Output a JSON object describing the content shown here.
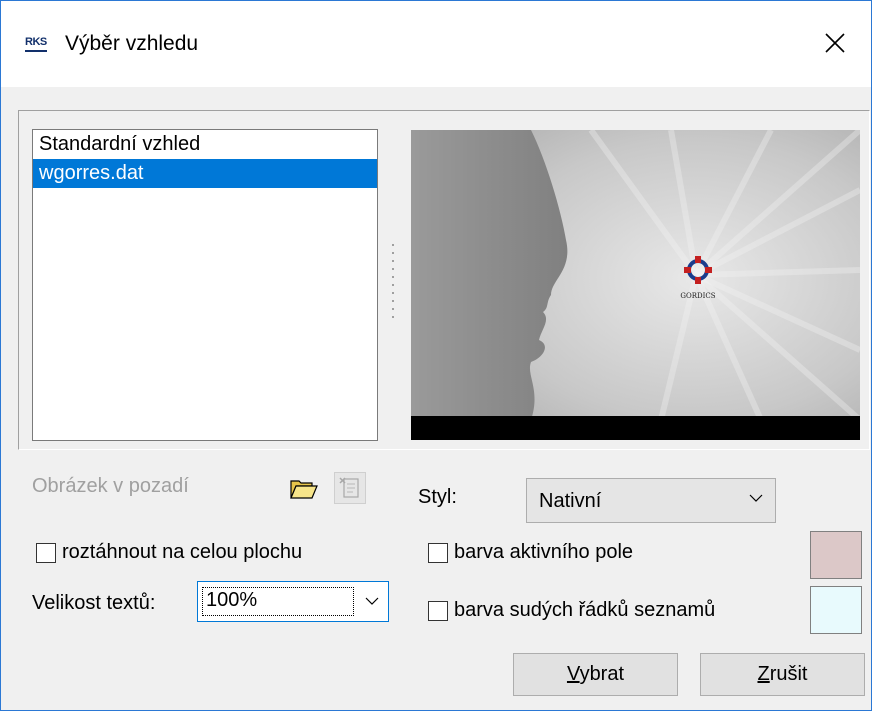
{
  "window": {
    "logo_text": "RKS",
    "title": "Výběr vzhledu"
  },
  "list": {
    "items": [
      "Standardní vzhled",
      "wgorres.dat"
    ],
    "selected_index": 1
  },
  "preview": {
    "logo_caption": "GORDICS"
  },
  "background": {
    "label": "Obrázek v pozadí"
  },
  "stretch": {
    "label": "roztáhnout na celou plochu",
    "checked": false
  },
  "text_size": {
    "label": "Velikost textů:",
    "value": "100%"
  },
  "style": {
    "label": "Styl:",
    "value": "Nativní"
  },
  "active_field_color": {
    "label": "barva aktivního pole",
    "checked": false,
    "color": "#dcc8c8"
  },
  "even_rows_color": {
    "label": "barva sudých řádků seznamů",
    "checked": false,
    "color": "#e8fafd"
  },
  "buttons": {
    "select_accel": "V",
    "select_rest": "ybrat",
    "cancel_accel": "Z",
    "cancel_rest": "rušit"
  }
}
